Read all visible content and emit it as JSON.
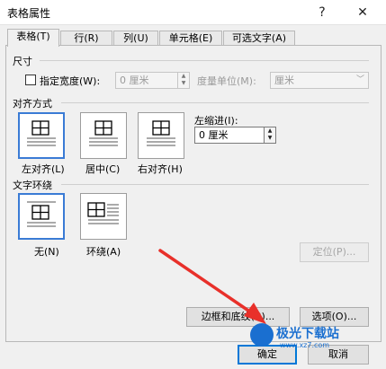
{
  "window": {
    "title": "表格属性",
    "help": "?",
    "close": "✕"
  },
  "tabs": [
    {
      "label": "表格(T)"
    },
    {
      "label": "行(R)"
    },
    {
      "label": "列(U)"
    },
    {
      "label": "单元格(E)"
    },
    {
      "label": "可选文字(A)"
    }
  ],
  "size": {
    "heading": "尺寸",
    "specify_width_label": "指定宽度(W):",
    "width_value": "0 厘米",
    "unit_label": "度量单位(M):",
    "unit_value": "厘米"
  },
  "alignment": {
    "heading": "对齐方式",
    "options": [
      {
        "label": "左对齐(L)"
      },
      {
        "label": "居中(C)"
      },
      {
        "label": "右对齐(H)"
      }
    ],
    "indent_label": "左缩进(I):",
    "indent_value": "0 厘米"
  },
  "wrap": {
    "heading": "文字环绕",
    "options": [
      {
        "label": "无(N)"
      },
      {
        "label": "环绕(A)"
      }
    ],
    "position_button": "定位(P)..."
  },
  "buttons": {
    "borders": "边框和底纹(B)...",
    "options": "选项(O)...",
    "ok": "确定",
    "cancel": "取消"
  },
  "watermark": {
    "text": "极光下载站",
    "url": "www.xz7.com"
  },
  "colors": {
    "selection": "#3a7bd5",
    "arrow": "#e8302a"
  }
}
